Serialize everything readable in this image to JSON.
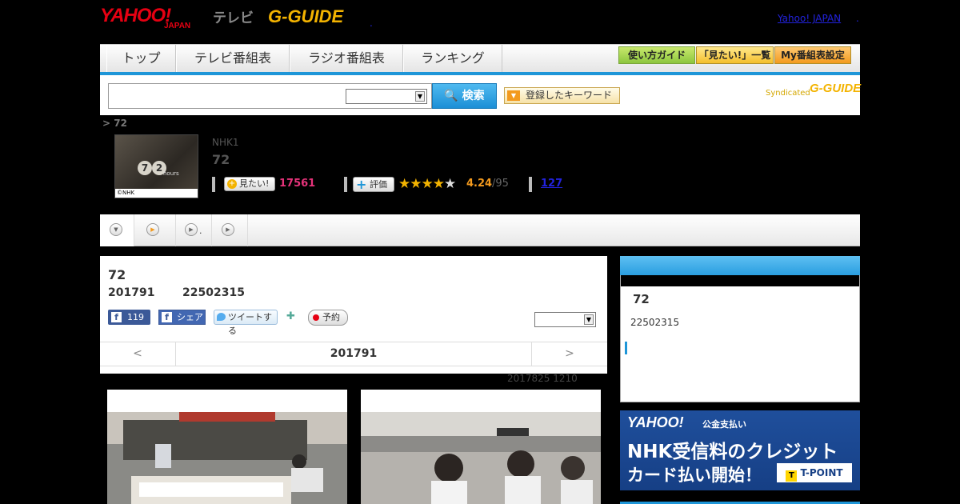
{
  "header": {
    "logo_yahoo": "YAHOO!",
    "logo_japan": "JAPAN",
    "logo_tv": "テレビ",
    "logo_gguide": "G-GUIDE",
    "yahoo_japan_link": "Yahoo! JAPAN",
    "dot": ".",
    "dot2": "."
  },
  "nav": {
    "items": [
      "トップ",
      "テレビ番組表",
      "ラジオ番組表",
      "ランキング"
    ],
    "buttons": [
      "使い方ガイド",
      "「見たい!」一覧",
      "My番組表設定"
    ]
  },
  "search": {
    "input_value": "",
    "select_value": "",
    "button_label": "検索",
    "keyword_button": "登録したキーワード",
    "syndicated": "Syndicated",
    "syndicated_logo": "G-GUIDE"
  },
  "program": {
    "breadcrumb": "> 72",
    "thumb_copyright": "©NHK",
    "thumb_hours": "hours",
    "channel": "NHK1",
    "title": "72",
    "mitai_label": "見たい!",
    "mitai_count": "17561",
    "hyoka_label": "評価",
    "stars_filled": "★★★★",
    "stars_empty": "★",
    "rating": "4.24",
    "rating_count": "/95",
    "review_count": "127"
  },
  "tabs": {
    "tab2_label": "."
  },
  "main": {
    "title": "72",
    "date": "201791",
    "time": "22502315",
    "fb_like_count": "119",
    "fb_share": "シェア",
    "tweet": "ツイートする",
    "yoyaku": "予約",
    "select_value": "",
    "pager_prev": "<",
    "pager_date": "201791",
    "pager_next": ">",
    "updated": "2017825  1210"
  },
  "sidebar": {
    "title": "72",
    "time": "22502315"
  },
  "ad": {
    "logo": "YAHOO!",
    "sub": "公金支払い",
    "line1": "NHK受信料のクレジット",
    "line2": "カード払い開始！",
    "tpoint": "T-POINT",
    "tpoint_t": "T"
  },
  "colors": {
    "accent_blue": "#1e96d8",
    "yahoo_red": "#e60012",
    "gguide_yellow": "#f3b300",
    "mitai_pink": "#e6337a"
  }
}
